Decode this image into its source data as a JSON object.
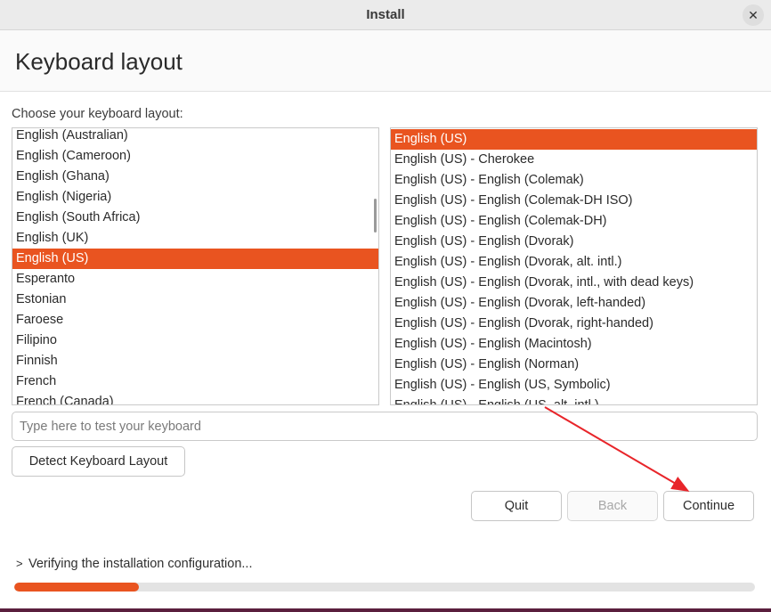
{
  "window": {
    "title": "Install"
  },
  "header": {
    "title": "Keyboard layout"
  },
  "prompt": "Choose your keyboard layout:",
  "layouts": [
    "English (Australian)",
    "English (Cameroon)",
    "English (Ghana)",
    "English (Nigeria)",
    "English (South Africa)",
    "English (UK)",
    "English (US)",
    "Esperanto",
    "Estonian",
    "Faroese",
    "Filipino",
    "Finnish",
    "French",
    "French (Canada)"
  ],
  "layouts_selected": "English (US)",
  "variants": [
    "English (US)",
    "English (US) - Cherokee",
    "English (US) - English (Colemak)",
    "English (US) - English (Colemak-DH ISO)",
    "English (US) - English (Colemak-DH)",
    "English (US) - English (Dvorak)",
    "English (US) - English (Dvorak, alt. intl.)",
    "English (US) - English (Dvorak, intl., with dead keys)",
    "English (US) - English (Dvorak, left-handed)",
    "English (US) - English (Dvorak, right-handed)",
    "English (US) - English (Macintosh)",
    "English (US) - English (Norman)",
    "English (US) - English (US, Symbolic)",
    "English (US) - English (US, alt. intl.)"
  ],
  "variants_selected": "English (US)",
  "test_input": {
    "placeholder": "Type here to test your keyboard",
    "value": ""
  },
  "buttons": {
    "detect": "Detect Keyboard Layout",
    "quit": "Quit",
    "back": "Back",
    "continue": "Continue"
  },
  "status": {
    "chevron": ">",
    "text": "Verifying the installation configuration...",
    "progress": 0.168
  },
  "colors": {
    "accent": "#e95420",
    "annotation_arrow": "#e8252a"
  }
}
